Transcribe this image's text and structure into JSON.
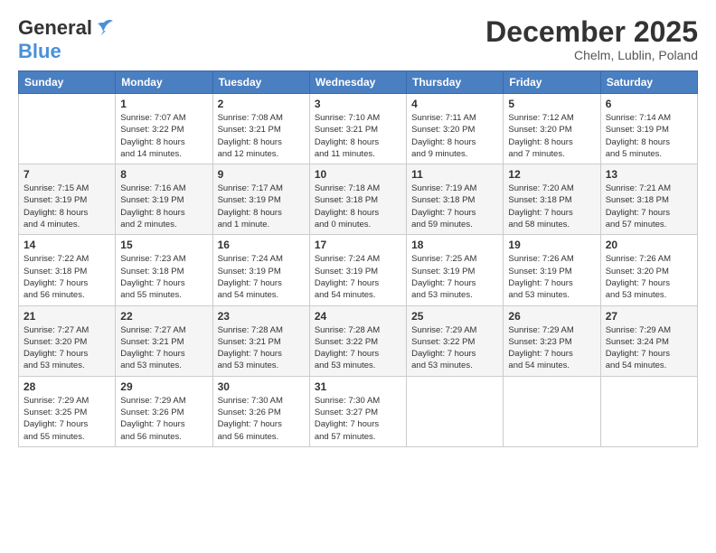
{
  "header": {
    "logo_general": "General",
    "logo_blue": "Blue",
    "month_title": "December 2025",
    "location": "Chelm, Lublin, Poland"
  },
  "days_of_week": [
    "Sunday",
    "Monday",
    "Tuesday",
    "Wednesday",
    "Thursday",
    "Friday",
    "Saturday"
  ],
  "weeks": [
    [
      {
        "day": "",
        "info": ""
      },
      {
        "day": "1",
        "info": "Sunrise: 7:07 AM\nSunset: 3:22 PM\nDaylight: 8 hours\nand 14 minutes."
      },
      {
        "day": "2",
        "info": "Sunrise: 7:08 AM\nSunset: 3:21 PM\nDaylight: 8 hours\nand 12 minutes."
      },
      {
        "day": "3",
        "info": "Sunrise: 7:10 AM\nSunset: 3:21 PM\nDaylight: 8 hours\nand 11 minutes."
      },
      {
        "day": "4",
        "info": "Sunrise: 7:11 AM\nSunset: 3:20 PM\nDaylight: 8 hours\nand 9 minutes."
      },
      {
        "day": "5",
        "info": "Sunrise: 7:12 AM\nSunset: 3:20 PM\nDaylight: 8 hours\nand 7 minutes."
      },
      {
        "day": "6",
        "info": "Sunrise: 7:14 AM\nSunset: 3:19 PM\nDaylight: 8 hours\nand 5 minutes."
      }
    ],
    [
      {
        "day": "7",
        "info": "Sunrise: 7:15 AM\nSunset: 3:19 PM\nDaylight: 8 hours\nand 4 minutes."
      },
      {
        "day": "8",
        "info": "Sunrise: 7:16 AM\nSunset: 3:19 PM\nDaylight: 8 hours\nand 2 minutes."
      },
      {
        "day": "9",
        "info": "Sunrise: 7:17 AM\nSunset: 3:19 PM\nDaylight: 8 hours\nand 1 minute."
      },
      {
        "day": "10",
        "info": "Sunrise: 7:18 AM\nSunset: 3:18 PM\nDaylight: 8 hours\nand 0 minutes."
      },
      {
        "day": "11",
        "info": "Sunrise: 7:19 AM\nSunset: 3:18 PM\nDaylight: 7 hours\nand 59 minutes."
      },
      {
        "day": "12",
        "info": "Sunrise: 7:20 AM\nSunset: 3:18 PM\nDaylight: 7 hours\nand 58 minutes."
      },
      {
        "day": "13",
        "info": "Sunrise: 7:21 AM\nSunset: 3:18 PM\nDaylight: 7 hours\nand 57 minutes."
      }
    ],
    [
      {
        "day": "14",
        "info": "Sunrise: 7:22 AM\nSunset: 3:18 PM\nDaylight: 7 hours\nand 56 minutes."
      },
      {
        "day": "15",
        "info": "Sunrise: 7:23 AM\nSunset: 3:18 PM\nDaylight: 7 hours\nand 55 minutes."
      },
      {
        "day": "16",
        "info": "Sunrise: 7:24 AM\nSunset: 3:19 PM\nDaylight: 7 hours\nand 54 minutes."
      },
      {
        "day": "17",
        "info": "Sunrise: 7:24 AM\nSunset: 3:19 PM\nDaylight: 7 hours\nand 54 minutes."
      },
      {
        "day": "18",
        "info": "Sunrise: 7:25 AM\nSunset: 3:19 PM\nDaylight: 7 hours\nand 53 minutes."
      },
      {
        "day": "19",
        "info": "Sunrise: 7:26 AM\nSunset: 3:19 PM\nDaylight: 7 hours\nand 53 minutes."
      },
      {
        "day": "20",
        "info": "Sunrise: 7:26 AM\nSunset: 3:20 PM\nDaylight: 7 hours\nand 53 minutes."
      }
    ],
    [
      {
        "day": "21",
        "info": "Sunrise: 7:27 AM\nSunset: 3:20 PM\nDaylight: 7 hours\nand 53 minutes."
      },
      {
        "day": "22",
        "info": "Sunrise: 7:27 AM\nSunset: 3:21 PM\nDaylight: 7 hours\nand 53 minutes."
      },
      {
        "day": "23",
        "info": "Sunrise: 7:28 AM\nSunset: 3:21 PM\nDaylight: 7 hours\nand 53 minutes."
      },
      {
        "day": "24",
        "info": "Sunrise: 7:28 AM\nSunset: 3:22 PM\nDaylight: 7 hours\nand 53 minutes."
      },
      {
        "day": "25",
        "info": "Sunrise: 7:29 AM\nSunset: 3:22 PM\nDaylight: 7 hours\nand 53 minutes."
      },
      {
        "day": "26",
        "info": "Sunrise: 7:29 AM\nSunset: 3:23 PM\nDaylight: 7 hours\nand 54 minutes."
      },
      {
        "day": "27",
        "info": "Sunrise: 7:29 AM\nSunset: 3:24 PM\nDaylight: 7 hours\nand 54 minutes."
      }
    ],
    [
      {
        "day": "28",
        "info": "Sunrise: 7:29 AM\nSunset: 3:25 PM\nDaylight: 7 hours\nand 55 minutes."
      },
      {
        "day": "29",
        "info": "Sunrise: 7:29 AM\nSunset: 3:26 PM\nDaylight: 7 hours\nand 56 minutes."
      },
      {
        "day": "30",
        "info": "Sunrise: 7:30 AM\nSunset: 3:26 PM\nDaylight: 7 hours\nand 56 minutes."
      },
      {
        "day": "31",
        "info": "Sunrise: 7:30 AM\nSunset: 3:27 PM\nDaylight: 7 hours\nand 57 minutes."
      },
      {
        "day": "",
        "info": ""
      },
      {
        "day": "",
        "info": ""
      },
      {
        "day": "",
        "info": ""
      }
    ]
  ]
}
